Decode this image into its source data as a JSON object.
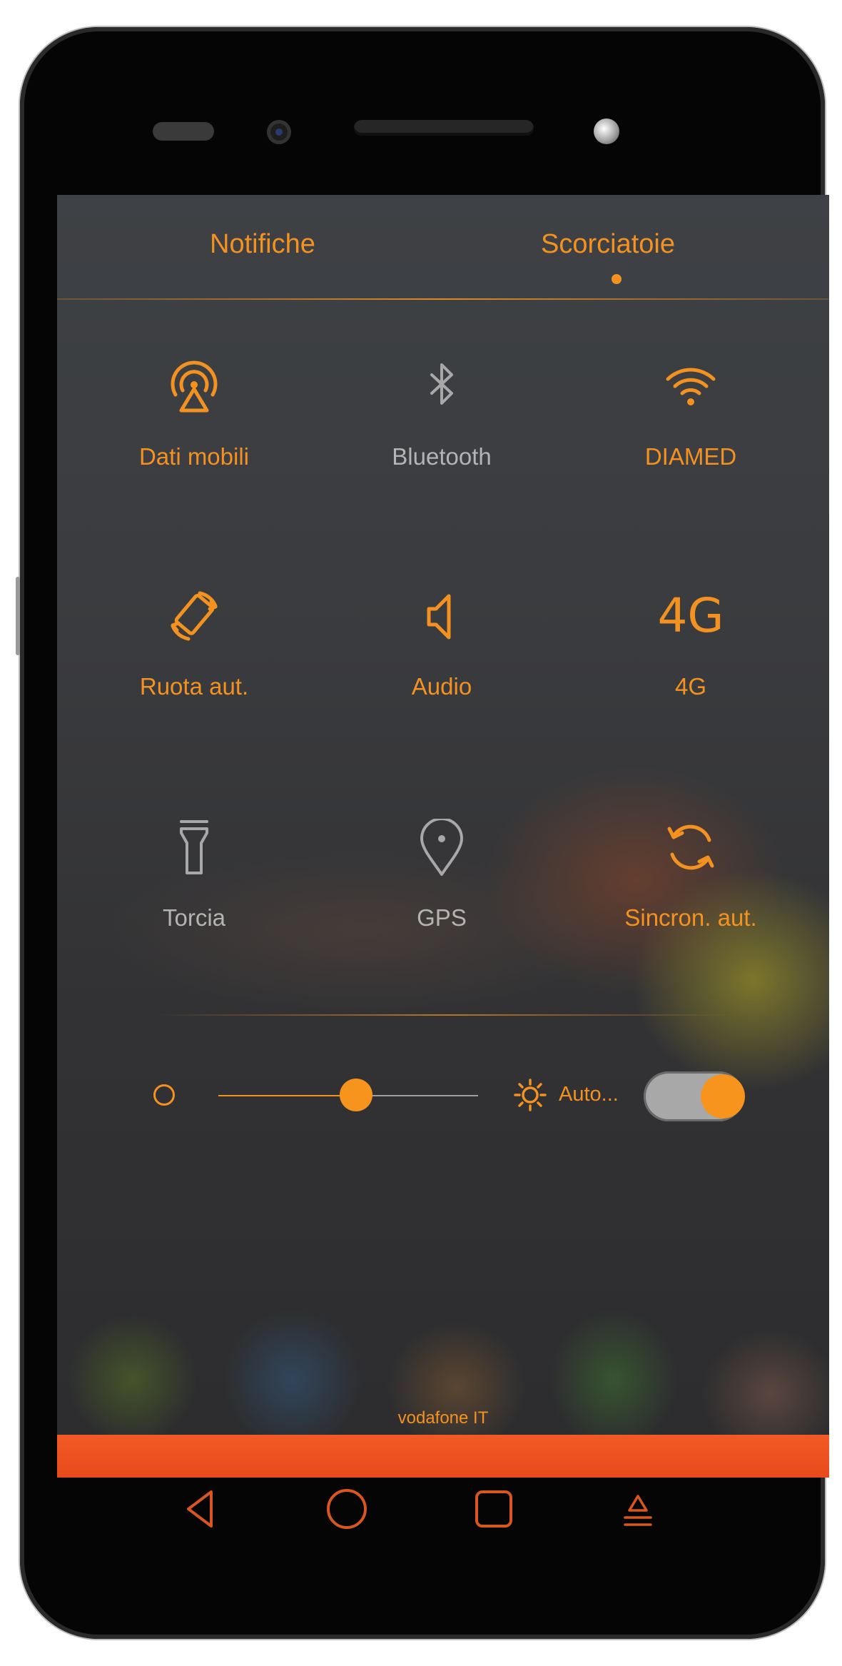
{
  "tabs": [
    {
      "label": "Notifiche",
      "active": false
    },
    {
      "label": "Scorciatoie",
      "active": true
    }
  ],
  "tiles": [
    {
      "label": "Dati mobili",
      "icon": "mobile-data-icon",
      "state": "on"
    },
    {
      "label": "Bluetooth",
      "icon": "bluetooth-icon",
      "state": "off"
    },
    {
      "label": "DIAMED",
      "icon": "wifi-icon",
      "state": "on"
    },
    {
      "label": "Ruota aut.",
      "icon": "auto-rotate-icon",
      "state": "on"
    },
    {
      "label": "Audio",
      "icon": "speaker-icon",
      "state": "on"
    },
    {
      "label": "4G",
      "icon": "4g-icon",
      "icon_text": "4G",
      "state": "on"
    },
    {
      "label": "Torcia",
      "icon": "flashlight-icon",
      "state": "off"
    },
    {
      "label": "GPS",
      "icon": "location-pin-icon",
      "state": "off"
    },
    {
      "label": "Sincron. aut.",
      "icon": "sync-icon",
      "state": "on"
    }
  ],
  "brightness": {
    "level": 0.53,
    "auto_label": "Auto...",
    "auto_enabled": true
  },
  "status": {
    "carrier": "vodafone IT"
  },
  "nav": [
    "back-icon",
    "home-icon",
    "recents-icon",
    "notification-shade-icon"
  ],
  "colors": {
    "accent": "#f39221",
    "inactive": "#b4b4b4",
    "bar": "#ee5022"
  }
}
